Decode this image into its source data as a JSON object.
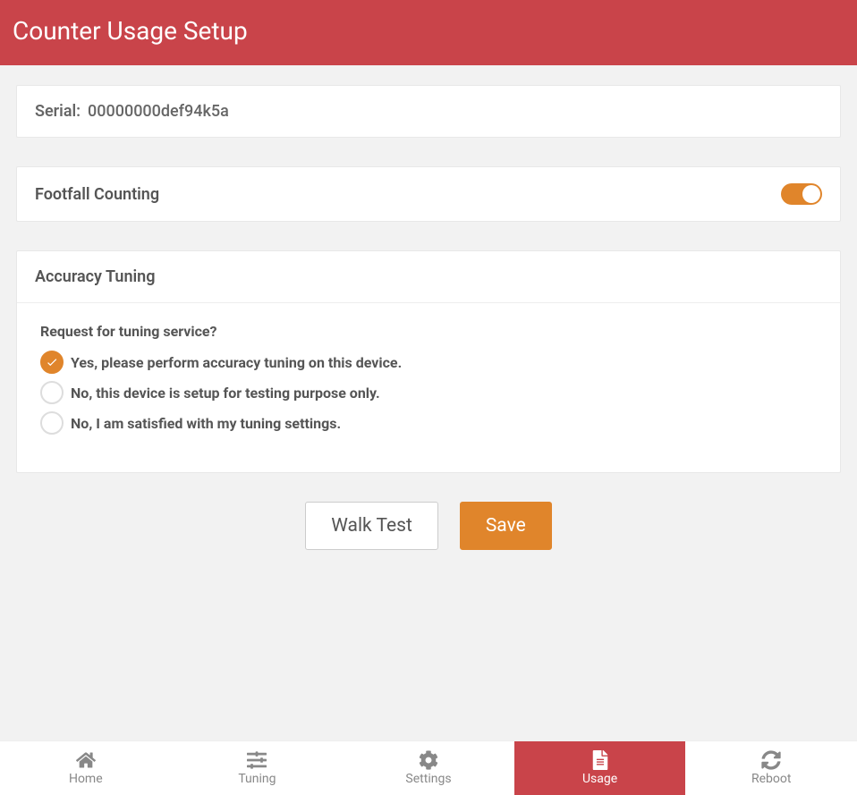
{
  "header": {
    "title": "Counter Usage Setup"
  },
  "serial": {
    "label": "Serial:",
    "value": "00000000def94k5a"
  },
  "footfall": {
    "label": "Footfall Counting",
    "enabled": true
  },
  "accuracy": {
    "title": "Accuracy Tuning",
    "question": "Request for tuning service?",
    "options": [
      {
        "label": "Yes, please perform accuracy tuning on this device.",
        "selected": true
      },
      {
        "label": "No, this device is setup for testing purpose only.",
        "selected": false
      },
      {
        "label": "No, I am satisfied with my tuning settings.",
        "selected": false
      }
    ]
  },
  "actions": {
    "walk_test": "Walk Test",
    "save": "Save"
  },
  "nav": {
    "items": [
      {
        "label": "Home",
        "icon": "home",
        "active": false
      },
      {
        "label": "Tuning",
        "icon": "sliders",
        "active": false
      },
      {
        "label": "Settings",
        "icon": "gear",
        "active": false
      },
      {
        "label": "Usage",
        "icon": "file",
        "active": true
      },
      {
        "label": "Reboot",
        "icon": "refresh",
        "active": false
      }
    ]
  }
}
